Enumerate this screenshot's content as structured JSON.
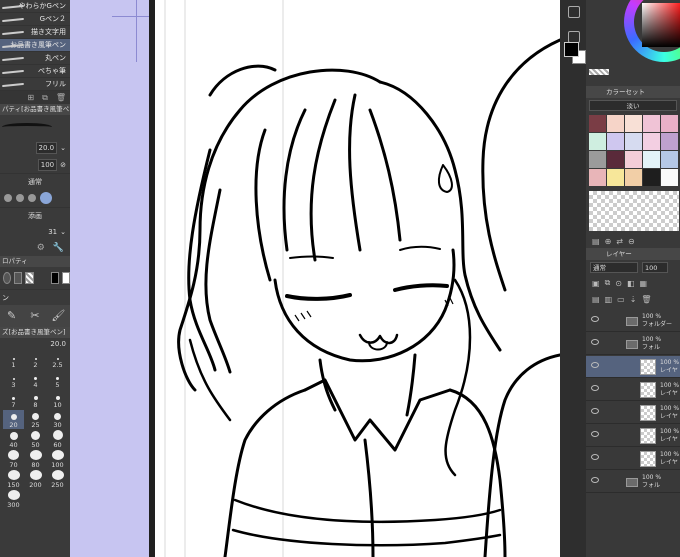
{
  "brushes": [
    {
      "label": "やわらかGペン"
    },
    {
      "label": "Gペン２"
    },
    {
      "label": "描き文字用"
    },
    {
      "label": "お品書き風筆ペン",
      "selected": true
    },
    {
      "label": "丸ペン"
    },
    {
      "label": "ぺちゃ筆"
    },
    {
      "label": "フリル"
    }
  ],
  "left": {
    "tool_property_title": "パティ[お品書き風筆ペン",
    "brush_size_value": "20.0",
    "opacity_value": "100",
    "blend_mode": "通常",
    "anti_alias_label": "添画",
    "stabilizer_value": "31",
    "sub_property_title": "ロパティ",
    "misc_label": "ン",
    "brush_size_panel_title": "ズ[お品書き風筆ペン]",
    "brush_size_display": "20.0",
    "sizes": [
      "1",
      "2",
      "2.5",
      "3",
      "4",
      "5",
      "7",
      "8",
      "10",
      "20",
      "25",
      "30",
      "40",
      "50",
      "60",
      "70",
      "80",
      "100",
      "150",
      "200",
      "250",
      "300"
    ]
  },
  "right": {
    "colorset_title": "カラーセット",
    "colorset_select": "淡い",
    "layer_title": "レイヤー",
    "blend_mode": "通常",
    "opacity": "100",
    "swatches": [
      "#7a3d45",
      "#f6d4c8",
      "#f8e0d6",
      "#f0c3d6",
      "#e9b0c7",
      "#cfeee0",
      "#cfc7ef",
      "#d6dbf0",
      "#f3cfe2",
      "#bfa1cf",
      "#9b9b9b",
      "#5a2a3a",
      "#f3cdd8",
      "#e3f3f8",
      "#b5c8e6",
      "#e8b5b8",
      "#f7e79a",
      "#f2cfa7",
      "#1e1e1e",
      "#f9fafa"
    ],
    "layers": [
      {
        "line1": "100 %",
        "line2": "フォルダー",
        "type": "folder"
      },
      {
        "line1": "100 %",
        "line2": "フォル",
        "type": "folder"
      },
      {
        "line1": "100 %",
        "line2": "レイヤ",
        "type": "layer",
        "selected": true
      },
      {
        "line1": "100 %",
        "line2": "レイヤ",
        "type": "layer"
      },
      {
        "line1": "100 %",
        "line2": "レイヤ",
        "type": "layer"
      },
      {
        "line1": "100 %",
        "line2": "レイヤ",
        "type": "layer"
      },
      {
        "line1": "100 %",
        "line2": "レイヤ",
        "type": "layer"
      },
      {
        "line1": "100 %",
        "line2": "フォル",
        "type": "folder"
      }
    ]
  }
}
